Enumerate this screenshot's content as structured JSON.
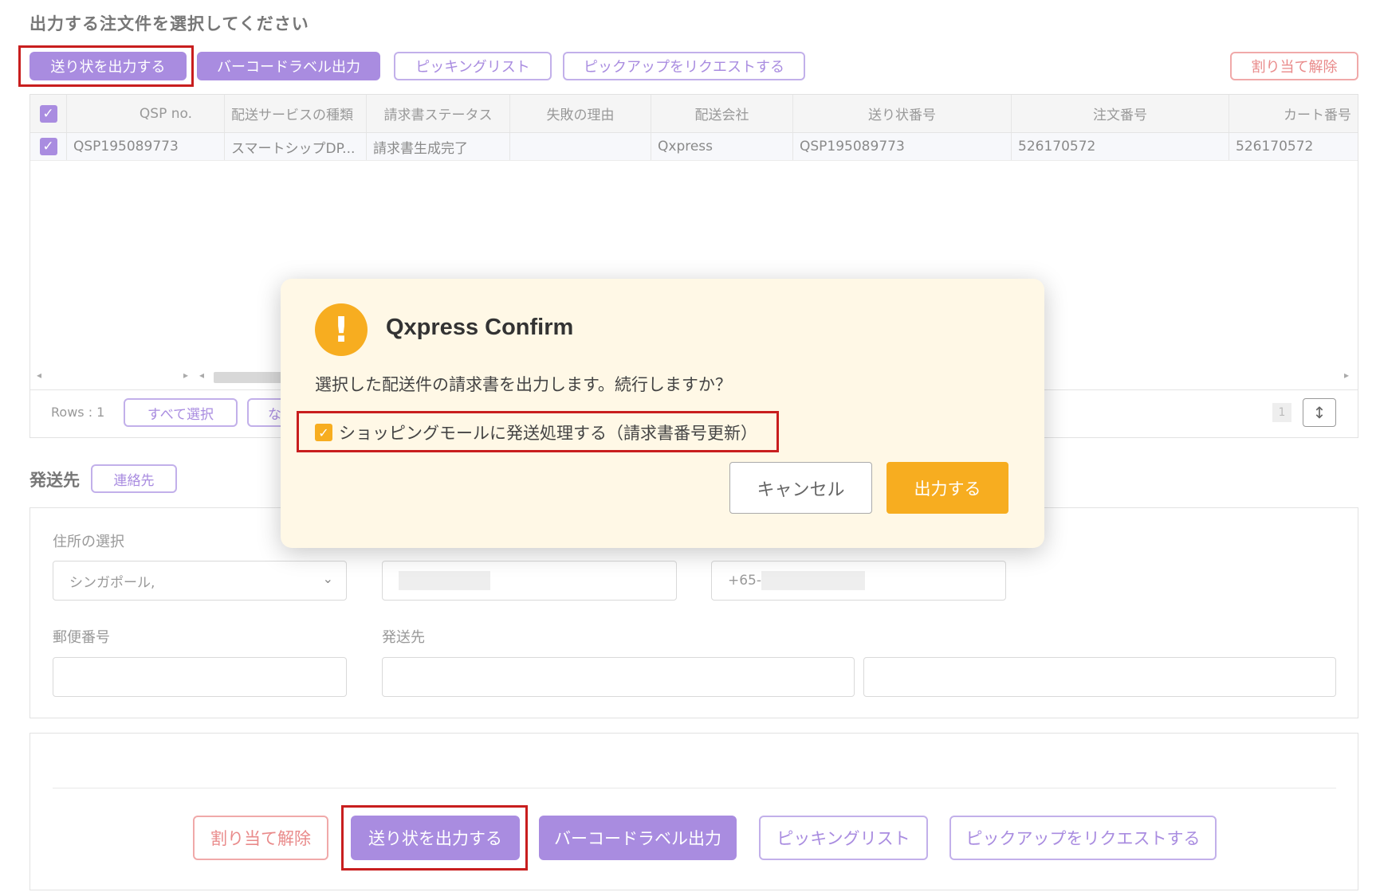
{
  "page": {
    "title": "出力する注文件を選択してください"
  },
  "toolbar": {
    "print_waybill": "送り状を出力する",
    "barcode_label": "バーコードラベル出力",
    "picking_list": "ピッキングリスト",
    "request_pickup": "ピックアップをリクエストする",
    "unassign": "割り当て解除"
  },
  "grid": {
    "headers": [
      "QSP no.",
      "配送サービスの種類",
      "請求書ステータス",
      "失敗の理由",
      "配送会社",
      "送り状番号",
      "注文番号",
      "カート番号"
    ],
    "rows": [
      [
        "QSP195089773",
        "スマートシップDP...",
        "請求書生成完了",
        "",
        "Qxpress",
        "QSP195089773",
        "526170572",
        "526170572"
      ]
    ],
    "rows_count": "Rows : 1",
    "select_all": "すべて選択",
    "deselect_partial": "な",
    "page_number": "1"
  },
  "shipping": {
    "label": "発送先",
    "contact_button": "連絡先",
    "address_select_label": "住所の選択",
    "address_select_value": "シンガポール,",
    "phone_prefix": "+65-",
    "postal_label": "郵便番号",
    "destination_label": "発送先"
  },
  "bottom_actions": {
    "unassign": "割り当て解除",
    "print_waybill": "送り状を出力する",
    "barcode_label": "バーコードラベル出力",
    "picking_list": "ピッキングリスト",
    "request_pickup": "ピックアップをリクエストする"
  },
  "modal": {
    "icon": "!",
    "title": "Qxpress Confirm",
    "message": "選択した配送件の請求書を出力します。続行しますか？",
    "checkbox_label": "ショッピングモールに発送処理する（請求書番号更新）",
    "checkbox_checked": true,
    "cancel": "キャンセル",
    "confirm": "出力する"
  },
  "colors": {
    "purple": "#a98ce0",
    "orange": "#f7ad20",
    "highlight": "#c81e1e",
    "red_text": "#e98a8a"
  }
}
